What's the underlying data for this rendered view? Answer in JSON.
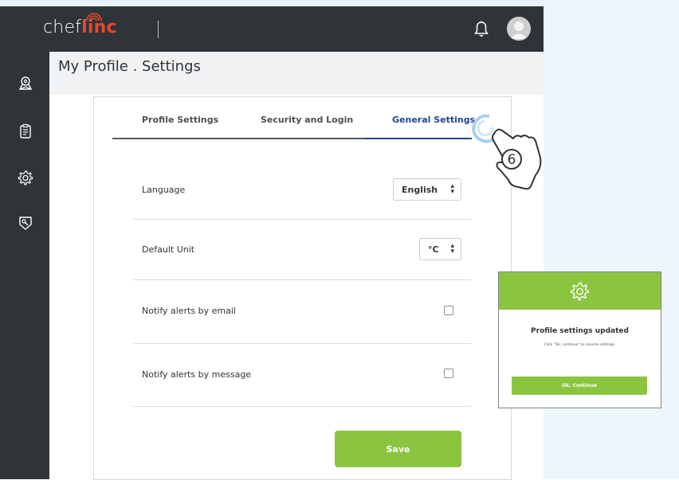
{
  "brand": {
    "logo_prefix": "chef",
    "logo_suffix": "linc"
  },
  "header": {
    "notifications_icon": "bell-icon",
    "avatar_icon": "user-avatar-icon"
  },
  "sidebar": {
    "items": [
      {
        "icon": "location-badge-icon"
      },
      {
        "icon": "document-list-icon"
      },
      {
        "icon": "gear-icon"
      },
      {
        "icon": "tag-wrench-icon"
      }
    ]
  },
  "page": {
    "title": "My Profile . Settings"
  },
  "tabs": [
    {
      "label": "Profile Settings",
      "active": false
    },
    {
      "label": "Security and Login",
      "active": false
    },
    {
      "label": "General Settings",
      "active": true
    }
  ],
  "settings": {
    "language": {
      "label": "Language",
      "value": "English"
    },
    "default_unit": {
      "label": "Default Unit",
      "value": "°C"
    },
    "notify_email": {
      "label": "Notify alerts by email",
      "checked": false
    },
    "notify_message": {
      "label": "Notify alerts by message",
      "checked": false
    }
  },
  "save_button": {
    "label": "Save"
  },
  "callout": {
    "step_number": "6",
    "icon": "pointing-hand-icon"
  },
  "modal": {
    "icon": "gear-icon",
    "title": "Profile settings updated",
    "subtitle": "Click \"Ok, continue\" to resume settings.",
    "button_label": "Ok, Continue"
  },
  "colors": {
    "accent_green": "#8bc53f",
    "header_dark": "#2f3438",
    "active_tab_blue": "#22449a",
    "brand_red": "#e5492f"
  }
}
